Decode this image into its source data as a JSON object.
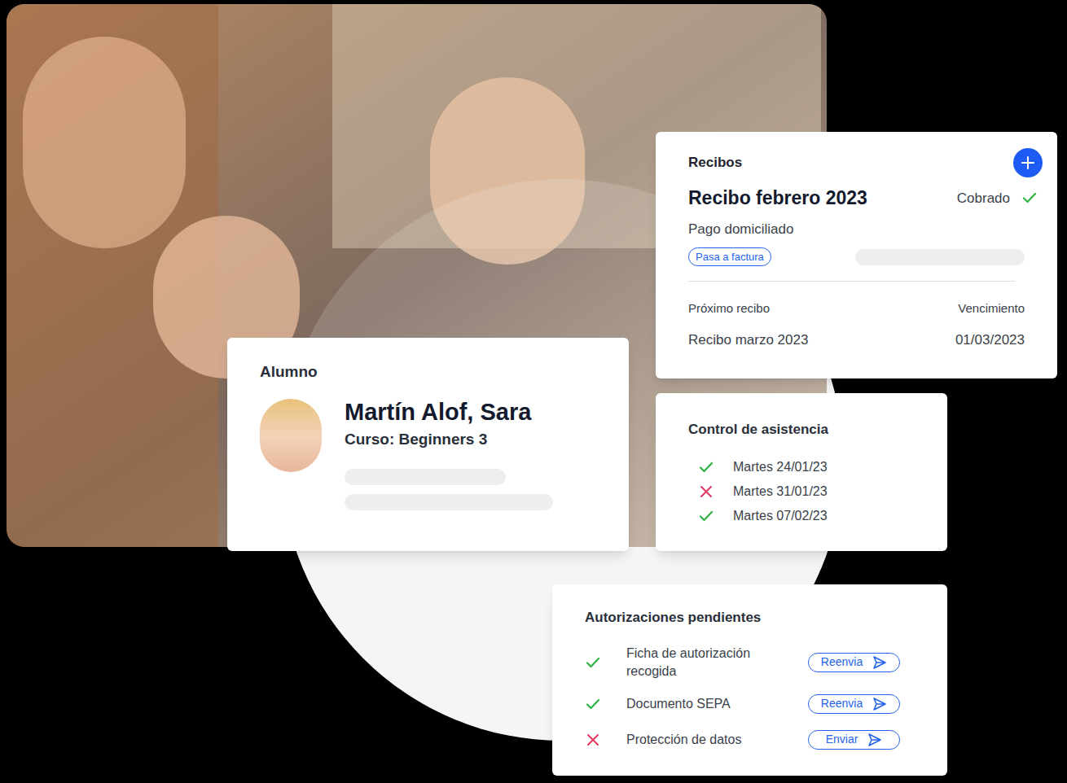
{
  "recibos": {
    "title": "Recibos",
    "receipt": {
      "title": "Recibo febrero 2023",
      "status": "Cobrado",
      "paid": true,
      "method": "Pago domiciliado",
      "button": "Pasa a factura"
    },
    "next_label": "Próximo recibo",
    "due_label": "Vencimiento",
    "next": "Recibo marzo 2023",
    "due": "01/03/2023"
  },
  "alumno": {
    "label": "Alumno",
    "name": "Martín Alof, Sara",
    "course": "Curso: Beginners 3"
  },
  "asistencia": {
    "title": "Control de asistencia",
    "items": [
      {
        "date": "Martes 24/01/23",
        "present": true
      },
      {
        "date": "Martes 31/01/23",
        "present": false
      },
      {
        "date": "Martes 07/02/23",
        "present": true
      }
    ]
  },
  "autorizaciones": {
    "title": "Autorizaciones pendientes",
    "items": [
      {
        "label": "Ficha de autorización recogida",
        "done": true,
        "action": "Reenvia"
      },
      {
        "label": "Documento SEPA",
        "done": true,
        "action": "Reenvia"
      },
      {
        "label": "Protección de datos",
        "done": false,
        "action": "Enviar"
      }
    ]
  }
}
